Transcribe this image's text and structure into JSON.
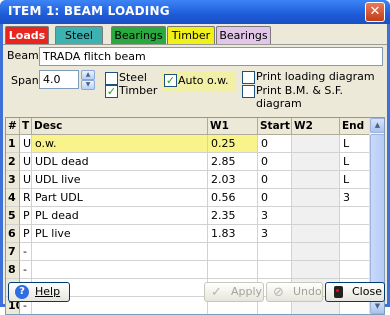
{
  "window": {
    "title": "ITEM 1: BEAM LOADING",
    "close_glyph": "✕"
  },
  "tabs": [
    {
      "label": "Loads",
      "bg": "#e8251e",
      "fg": "#ffffff"
    },
    {
      "label": "Steel",
      "bg": "#3cb3b0",
      "fg": "#000000"
    },
    {
      "label": "Bearings",
      "bg": "#2aa93e",
      "fg": "#000000"
    },
    {
      "label": "Timber",
      "bg": "#f2f019",
      "fg": "#000000"
    },
    {
      "label": "Bearings",
      "bg": "#e2c6e8",
      "fg": "#000000"
    }
  ],
  "beam": {
    "label": "Beam:",
    "value": "TRADA flitch beam"
  },
  "span": {
    "label": "Span:",
    "value": "4.0"
  },
  "checks": {
    "steel": {
      "label": "Steel",
      "checked": false
    },
    "timber": {
      "label": "Timber",
      "checked": true
    },
    "auto_ow": {
      "label": "Auto o.w.",
      "checked": true
    },
    "print_loading": {
      "label": "Print loading diagram",
      "checked": false
    },
    "print_bm": {
      "label": "Print B.M. & S.F. diagram",
      "checked": false
    }
  },
  "table": {
    "headers": [
      "#",
      "T",
      "Desc",
      "W1",
      "Start",
      "W2",
      "End"
    ],
    "rows": [
      {
        "n": "1",
        "t": "U",
        "desc": "o.w.",
        "w1": "0.25",
        "start": "0",
        "w2": "",
        "end": "L"
      },
      {
        "n": "2",
        "t": "U",
        "desc": "UDL dead",
        "w1": "2.85",
        "start": "0",
        "w2": "",
        "end": "L"
      },
      {
        "n": "3",
        "t": "U",
        "desc": "UDL live",
        "w1": "2.03",
        "start": "0",
        "w2": "",
        "end": "L"
      },
      {
        "n": "4",
        "t": "R",
        "desc": "Part UDL",
        "w1": "0.56",
        "start": "0",
        "w2": "",
        "end": "3"
      },
      {
        "n": "5",
        "t": "P",
        "desc": "PL dead",
        "w1": "2.35",
        "start": "3",
        "w2": "",
        "end": ""
      },
      {
        "n": "6",
        "t": "P",
        "desc": "PL live",
        "w1": "1.83",
        "start": "3",
        "w2": "",
        "end": ""
      },
      {
        "n": "7",
        "t": "-",
        "desc": "",
        "w1": "",
        "start": "",
        "w2": "",
        "end": ""
      },
      {
        "n": "8",
        "t": "-",
        "desc": "",
        "w1": "",
        "start": "",
        "w2": "",
        "end": ""
      },
      {
        "n": "9",
        "t": "-",
        "desc": "",
        "w1": "",
        "start": "",
        "w2": "",
        "end": ""
      },
      {
        "n": "10",
        "t": "-",
        "desc": "",
        "w1": "",
        "start": "",
        "w2": "",
        "end": ""
      }
    ]
  },
  "buttons": {
    "help": {
      "label": "Help",
      "icon": "?"
    },
    "apply": {
      "label": "Apply",
      "icon": "✓"
    },
    "undo": {
      "label": "Undo",
      "icon": "⊘"
    },
    "close": {
      "label": "Close"
    }
  },
  "colors": {
    "highlight_row": "#f8f38a",
    "auto_ow_bg": "#f2f0a6"
  }
}
